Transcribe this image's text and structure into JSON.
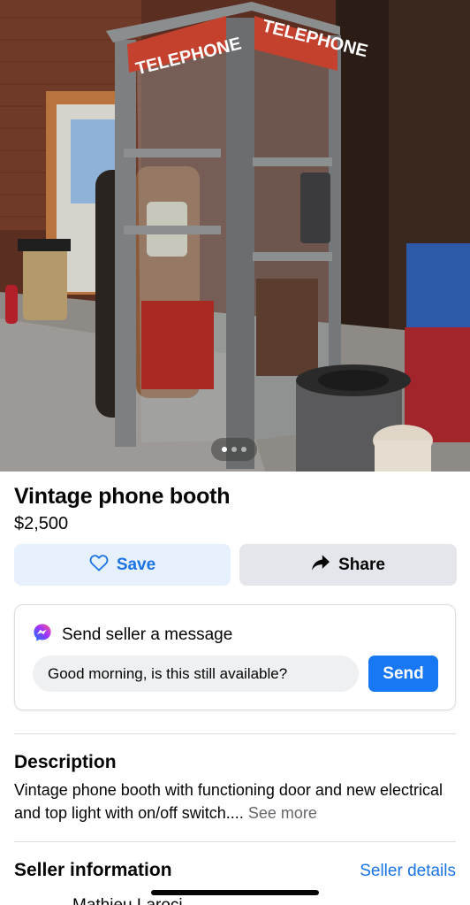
{
  "listing": {
    "title": "Vintage phone booth",
    "price": "$2,500",
    "photo": {
      "sign_text": "TELEPHONE",
      "slide_count": 3,
      "active_slide": 1
    }
  },
  "actions": {
    "save_label": "Save",
    "save_icon": "heart-outline-icon",
    "share_label": "Share",
    "share_icon": "share-arrow-icon"
  },
  "message": {
    "heading": "Send seller a message",
    "icon": "messenger-icon",
    "input_value": "Good morning, is this still available?",
    "send_label": "Send"
  },
  "description": {
    "heading": "Description",
    "text": "Vintage phone booth with functioning door and new electrical and top light with on/off switch....",
    "see_more_label": "See more"
  },
  "seller": {
    "heading": "Seller information",
    "details_link": "Seller details",
    "name_partial": "Mathieu Laroci..."
  },
  "colors": {
    "accent_blue": "#1877f2",
    "link_blue": "#1b74e4",
    "save_bg": "#e7f0fd",
    "neutral_button_bg": "#e4e6eb",
    "input_bg": "#eef0f2",
    "secondary_text": "#65676b",
    "booth_sign_red": "#c4412e"
  }
}
